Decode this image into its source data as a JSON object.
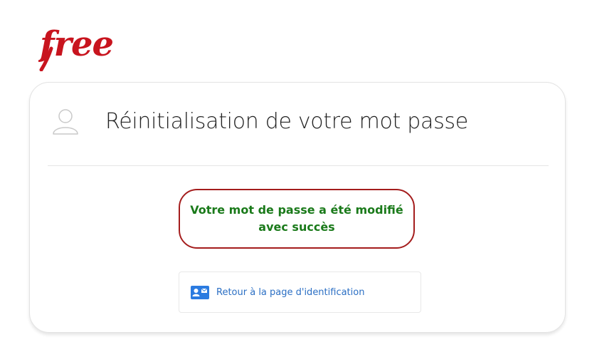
{
  "brand": {
    "logo_text": "free",
    "logo_color": "#c8141e"
  },
  "card": {
    "title": "Réinitialisation de votre mot passe"
  },
  "message": {
    "text": "Votre mot de passe a été modifié avec succès",
    "text_color": "#1a7a1a",
    "border_color": "#a41d1d"
  },
  "back_link": {
    "label": "Retour à la page d'identification",
    "icon": "id-card-icon",
    "color": "#2b6fc4"
  },
  "icons": {
    "header": "user-icon"
  }
}
